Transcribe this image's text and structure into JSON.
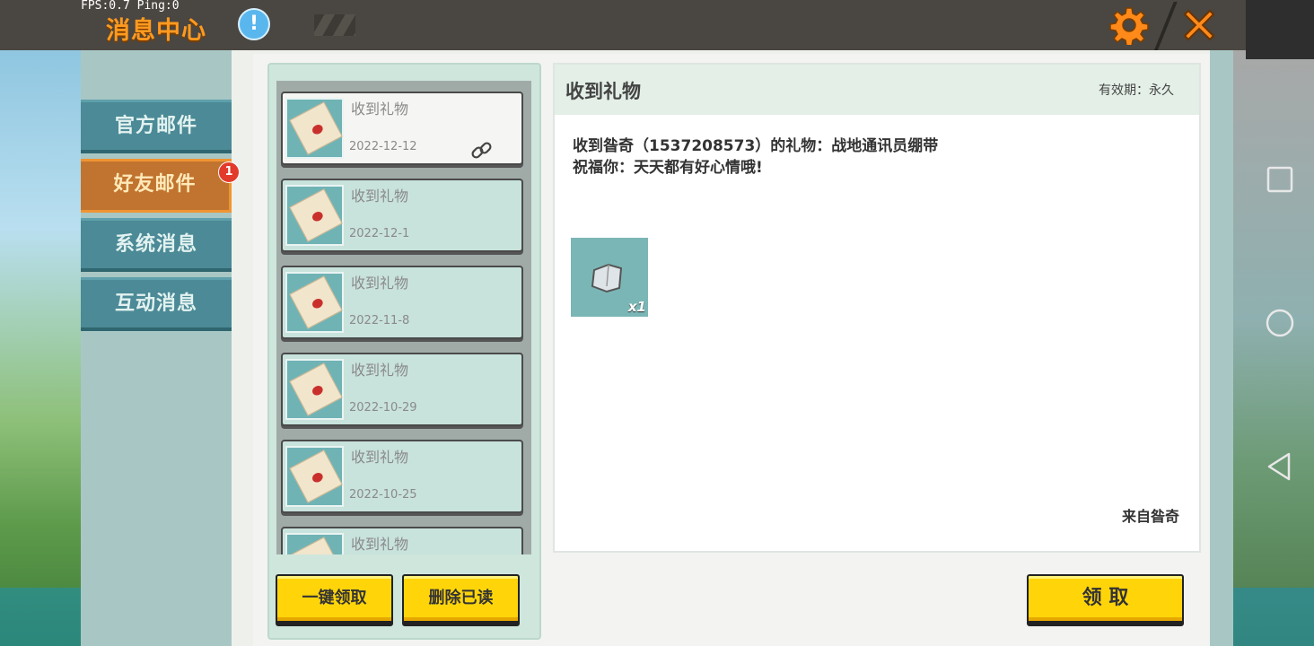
{
  "status": {
    "fps_text": "FPS:0.7  Ping:0"
  },
  "header": {
    "title": "消息中心",
    "info_icon": "!",
    "settings_icon": "gear-icon",
    "close_icon": "close-icon"
  },
  "nav": {
    "items": [
      {
        "label": "官方邮件",
        "active": false
      },
      {
        "label": "好友邮件",
        "active": true,
        "badge": "1"
      },
      {
        "label": "系统消息",
        "active": false
      },
      {
        "label": "互动消息",
        "active": false
      }
    ]
  },
  "mail_list": [
    {
      "title": "收到礼物",
      "date": "2022-12-12",
      "selected": true,
      "has_attachment": true
    },
    {
      "title": "收到礼物",
      "date": "2022-12-1"
    },
    {
      "title": "收到礼物",
      "date": "2022-11-8"
    },
    {
      "title": "收到礼物",
      "date": "2022-10-29"
    },
    {
      "title": "收到礼物",
      "date": "2022-10-25"
    },
    {
      "title": "收到礼物",
      "date": ""
    }
  ],
  "list_actions": {
    "claim_all": "一键领取",
    "delete_read": "删除已读"
  },
  "detail": {
    "title": "收到礼物",
    "validity": "有效期：永久",
    "line1": "收到昝奇（1537208573）的礼物：战地通讯员绷带",
    "line2": "祝福你：天天都有好心情哦!",
    "reward_qty": "x1",
    "from": "来自昝奇",
    "claim_button": "领 取"
  },
  "colors": {
    "accent_orange": "#ff9a1f",
    "button_yellow": "#ffd50a",
    "nav_teal": "#4b8a96",
    "nav_active": "#c1742f"
  }
}
